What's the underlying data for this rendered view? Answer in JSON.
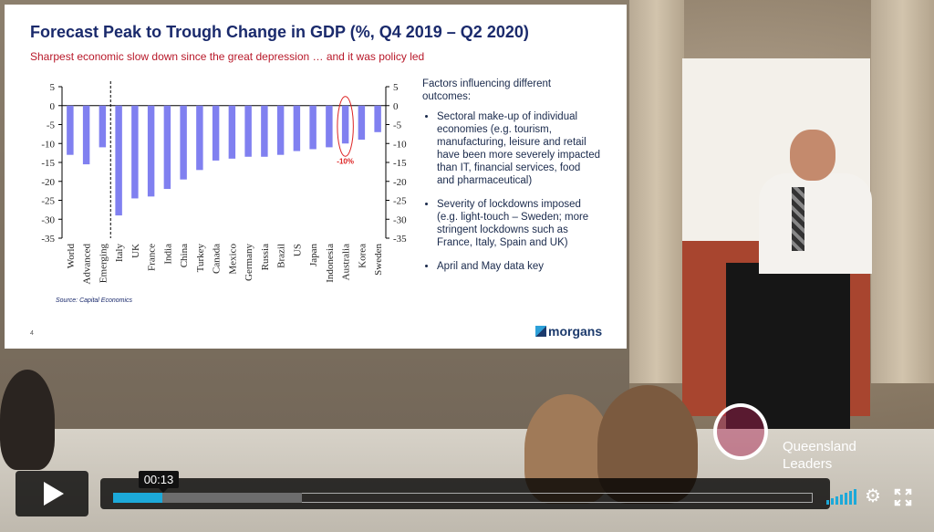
{
  "slide": {
    "title": "Forecast Peak to Trough Change in GDP (%, Q4 2019 – Q2 2020)",
    "subtitle": "Sharpest economic slow down since the great depression … and it was policy led",
    "source": "Source: Capital Economics",
    "page_number": "4",
    "logo_text": "morgans",
    "factors": {
      "heading": "Factors influencing different outcomes:",
      "bullets": [
        "Sectoral make-up of individual economies (e.g. tourism, manufacturing, leisure and retail have been more severely impacted than IT, financial services, food and pharmaceutical)",
        "Severity of lockdowns imposed (e.g. light-touch – Sweden; more stringent lockdowns such as France, Italy, Spain and UK)",
        "April and May data key"
      ]
    }
  },
  "chart_data": {
    "type": "bar",
    "categories": [
      "World",
      "Advanced",
      "Emerging",
      "Italy",
      "UK",
      "France",
      "India",
      "China",
      "Turkey",
      "Canada",
      "Mexico",
      "Germany",
      "Russia",
      "Brazil",
      "US",
      "Japan",
      "Indonesia",
      "Australia",
      "Korea",
      "Sweden"
    ],
    "values": [
      -13,
      -15.5,
      -11,
      -29,
      -24.5,
      -24,
      -22,
      -19.5,
      -17,
      -14.5,
      -14,
      -13.5,
      -13.5,
      -13,
      -12,
      -11.5,
      -11,
      -10,
      -9,
      -7
    ],
    "yticks": [
      5,
      0,
      -5,
      -10,
      -15,
      -20,
      -25,
      -30,
      -35
    ],
    "ylim": [
      -35,
      5
    ],
    "highlight_label": "-10%",
    "bar_color": "#8080f0"
  },
  "overlay": {
    "brand_line1": "Queensland",
    "brand_line2": "Leaders"
  },
  "player": {
    "time": "00:13",
    "progress": 0.07,
    "buffered": 0.27
  }
}
